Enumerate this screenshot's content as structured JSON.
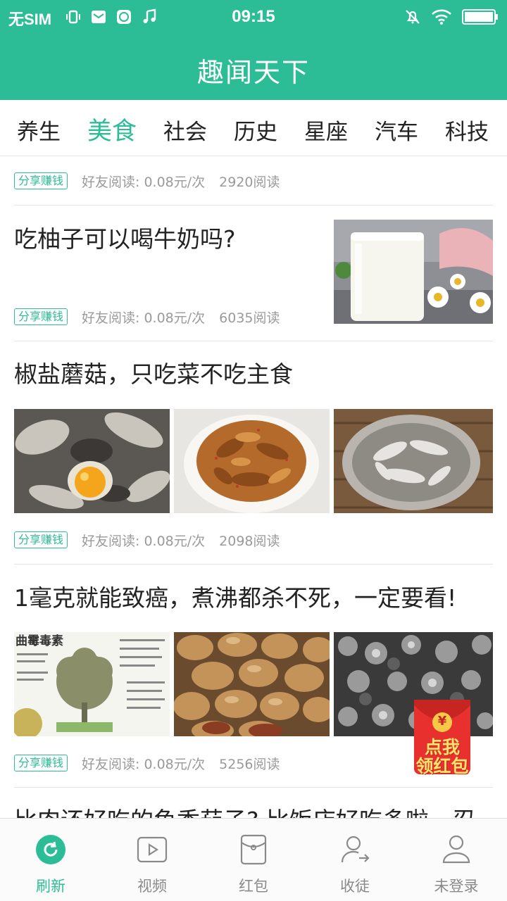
{
  "status_bar": {
    "carrier": "无SIM",
    "time": "09:15"
  },
  "app": {
    "title": "趣闻天下"
  },
  "categories": [
    {
      "label": "养生",
      "active": false
    },
    {
      "label": "美食",
      "active": true
    },
    {
      "label": "社会",
      "active": false
    },
    {
      "label": "历史",
      "active": false
    },
    {
      "label": "星座",
      "active": false
    },
    {
      "label": "汽车",
      "active": false
    },
    {
      "label": "科技",
      "active": false
    }
  ],
  "feed": {
    "items": [
      {
        "tag": "分享赚钱",
        "friend_read": "好友阅读: 0.08元/次",
        "reads": "2920阅读"
      },
      {
        "title": "吃柚子可以喝牛奶吗?",
        "tag": "分享赚钱",
        "friend_read": "好友阅读: 0.08元/次",
        "reads": "6035阅读"
      },
      {
        "title": "椒盐蘑菇，只吃菜不吃主食",
        "tag": "分享赚钱",
        "friend_read": "好友阅读: 0.08元/次",
        "reads": "2098阅读"
      },
      {
        "title": "1毫克就能致癌，煮沸都杀不死，一定要看!",
        "image_caption": "曲霉毒素",
        "tag": "分享赚钱",
        "friend_read": "好友阅读: 0.08元/次",
        "reads": "5256阅读"
      },
      {
        "title": "比肉还好吃的鱼香茄子? 比饭店好吃多啦，忍"
      }
    ]
  },
  "red_packet": {
    "line1": "点我",
    "line2": "领红包",
    "symbol": "¥"
  },
  "bottom_nav": [
    {
      "label": "刷新",
      "icon": "refresh-icon",
      "active": true
    },
    {
      "label": "视频",
      "icon": "video-icon",
      "active": false
    },
    {
      "label": "红包",
      "icon": "red-envelope-icon",
      "active": false
    },
    {
      "label": "收徒",
      "icon": "add-apprentice-icon",
      "active": false
    },
    {
      "label": "未登录",
      "icon": "user-icon",
      "active": false
    }
  ],
  "colors": {
    "brand": "#2dbd96",
    "text": "#222222",
    "muted": "#9a9a9a"
  }
}
